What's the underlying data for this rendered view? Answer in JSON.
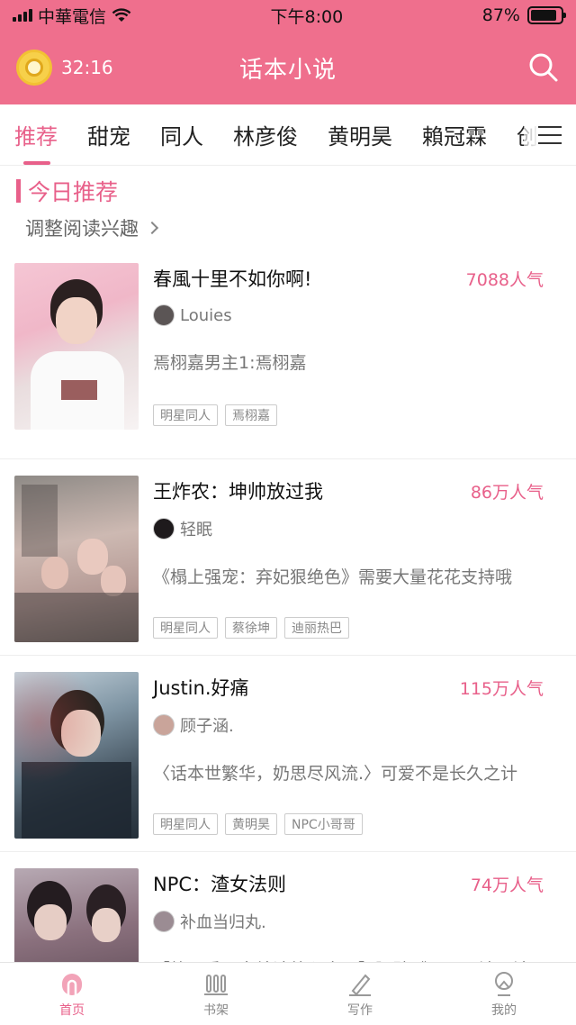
{
  "status": {
    "carrier": "中華電信",
    "time": "下午8:00",
    "battery": "87%",
    "battery_level": 0.87
  },
  "header": {
    "timer": "32:16",
    "title": "话本小说",
    "colors": {
      "brand": "#ef6f8d",
      "accent": "#e8608a"
    }
  },
  "tabs": [
    {
      "label": "推荐"
    },
    {
      "label": "甜宠"
    },
    {
      "label": "同人"
    },
    {
      "label": "林彦俊"
    },
    {
      "label": "黄明昊"
    },
    {
      "label": "賴冠霖"
    },
    {
      "label": "创"
    }
  ],
  "section": {
    "title": "今日推荐",
    "adjust_label": "调整阅读兴趣"
  },
  "books": [
    {
      "title": "春風十里不如你啊!",
      "popularity": "7088人气",
      "author": "Louies",
      "desc": "焉栩嘉男主1:焉栩嘉",
      "tags": [
        "明星同人",
        "焉栩嘉"
      ]
    },
    {
      "title": "王炸农：坤帅放过我",
      "popularity": "86万人气",
      "author": "轻眠",
      "desc": "《榻上强宠：弃妃狠绝色》需要大量花花支持哦",
      "tags": [
        "明星同人",
        "蔡徐坤",
        "迪丽热巴"
      ]
    },
    {
      "title": "Justin.好痛",
      "popularity": "115万人气",
      "author": "顾子涵.",
      "desc": "〈话本世繁华，奶思尽风流.〉可爱不是长久之计",
      "tags": [
        "明星同人",
        "黄明昊",
        "NPC小哥哥"
      ]
    },
    {
      "title": "NPC：渣女法则",
      "popularity": "74万人气",
      "author": "补血当归丸.",
      "desc": "【第一季已完结请放心食用】隔壁《NPC：渣男法则》",
      "tags": []
    }
  ],
  "bottom_nav": [
    {
      "label": "首页",
      "icon": "home-icon"
    },
    {
      "label": "书架",
      "icon": "bookshelf-icon"
    },
    {
      "label": "写作",
      "icon": "pen-icon"
    },
    {
      "label": "我的",
      "icon": "profile-icon"
    }
  ]
}
